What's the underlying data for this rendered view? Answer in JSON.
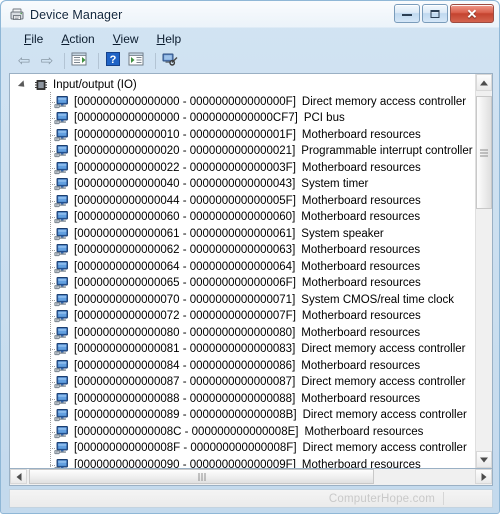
{
  "window": {
    "title": "Device Manager",
    "app_icon": "device-manager-icon",
    "controls": {
      "minimize": "minimize-button",
      "maximize": "maximize-button",
      "close": "close-button",
      "close_glyph": "✕"
    }
  },
  "menu": {
    "items": [
      {
        "label": "File",
        "accel": "F"
      },
      {
        "label": "Action",
        "accel": "A"
      },
      {
        "label": "View",
        "accel": "V"
      },
      {
        "label": "Help",
        "accel": "H"
      }
    ]
  },
  "toolbar": {
    "buttons": [
      {
        "name": "back-button",
        "icon": "arrow-left-icon",
        "glyph": "⇦"
      },
      {
        "name": "forward-button",
        "icon": "arrow-right-icon",
        "glyph": "⇨"
      },
      {
        "name": "show-hide-console-tree-button",
        "icon": "console-tree-icon"
      },
      {
        "name": "help-button",
        "icon": "question-mark-icon",
        "glyph": "?"
      },
      {
        "name": "properties-button",
        "icon": "properties-icon"
      },
      {
        "name": "scan-for-hardware-changes-button",
        "icon": "scan-hardware-icon"
      }
    ]
  },
  "tree": {
    "root": {
      "label": "Input/output (IO)",
      "icon": "chip-icon",
      "expanded": true
    },
    "rows": [
      {
        "address": "[0000000000000000 - 000000000000000F]",
        "device": "Direct memory access controller"
      },
      {
        "address": "[0000000000000000 - 0000000000000CF7]",
        "device": "PCI bus"
      },
      {
        "address": "[0000000000000010 - 000000000000001F]",
        "device": "Motherboard resources"
      },
      {
        "address": "[0000000000000020 - 0000000000000021]",
        "device": "Programmable interrupt controller"
      },
      {
        "address": "[0000000000000022 - 000000000000003F]",
        "device": "Motherboard resources"
      },
      {
        "address": "[0000000000000040 - 0000000000000043]",
        "device": "System timer"
      },
      {
        "address": "[0000000000000044 - 000000000000005F]",
        "device": "Motherboard resources"
      },
      {
        "address": "[0000000000000060 - 0000000000000060]",
        "device": "Motherboard resources"
      },
      {
        "address": "[0000000000000061 - 0000000000000061]",
        "device": "System speaker"
      },
      {
        "address": "[0000000000000062 - 0000000000000063]",
        "device": "Motherboard resources"
      },
      {
        "address": "[0000000000000064 - 0000000000000064]",
        "device": "Motherboard resources"
      },
      {
        "address": "[0000000000000065 - 000000000000006F]",
        "device": "Motherboard resources"
      },
      {
        "address": "[0000000000000070 - 0000000000000071]",
        "device": "System CMOS/real time clock"
      },
      {
        "address": "[0000000000000072 - 000000000000007F]",
        "device": "Motherboard resources"
      },
      {
        "address": "[0000000000000080 - 0000000000000080]",
        "device": "Motherboard resources"
      },
      {
        "address": "[0000000000000081 - 0000000000000083]",
        "device": "Direct memory access controller"
      },
      {
        "address": "[0000000000000084 - 0000000000000086]",
        "device": "Motherboard resources"
      },
      {
        "address": "[0000000000000087 - 0000000000000087]",
        "device": "Direct memory access controller"
      },
      {
        "address": "[0000000000000088 - 0000000000000088]",
        "device": "Motherboard resources"
      },
      {
        "address": "[0000000000000089 - 000000000000008B]",
        "device": "Direct memory access controller"
      },
      {
        "address": "[000000000000008C - 000000000000008E]",
        "device": "Motherboard resources"
      },
      {
        "address": "[000000000000008F - 000000000000008F]",
        "device": "Direct memory access controller"
      },
      {
        "address": "[0000000000000090 - 000000000000009F]",
        "device": "Motherboard resources"
      }
    ]
  },
  "statusbar": {
    "watermark": "ComputerHope.com"
  },
  "colors": {
    "frame": "#c3d8ec",
    "frame_border": "#8fb7d6",
    "close_red": "#c4432f",
    "content_bg": "#ffffff",
    "device_icon_blue": "#3a6ea5",
    "watermark_gray": "#c9c9c9"
  }
}
